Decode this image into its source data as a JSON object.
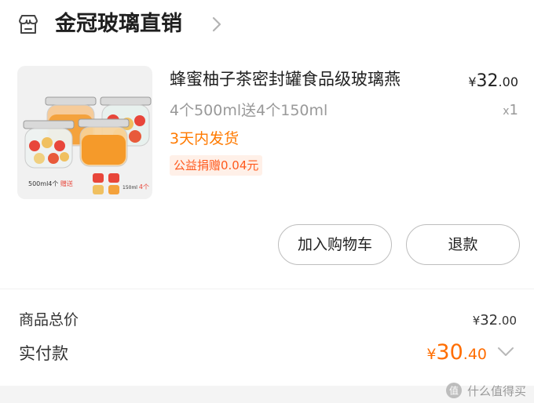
{
  "shop": {
    "name": "金冠玻璃直销"
  },
  "product": {
    "title": "蜂蜜柚子茶密封罐食品级玻璃燕",
    "price": {
      "currency": "¥",
      "integer": "32",
      "decimal": ".00"
    },
    "spec": "4个500ml送4个150ml",
    "quantity": "1",
    "quantity_prefix": "x",
    "shipping": "3天内发货",
    "charity": "公益捐赠0.04元",
    "image_caption_left": "500ml4个",
    "image_caption_gift": "赠送",
    "image_caption_right": "150ml",
    "image_caption_count": "4个"
  },
  "actions": {
    "add_to_cart": "加入购物车",
    "refund": "退款"
  },
  "summary": {
    "total_label": "商品总价",
    "total": {
      "currency": "¥",
      "integer": "32",
      "decimal": ".00"
    },
    "paid_label": "实付款",
    "paid": {
      "currency": "¥",
      "integer": "30",
      "decimal": ".40"
    }
  },
  "watermark": {
    "text": "什么值得买"
  },
  "colors": {
    "accent_orange": "#ff6d00",
    "shipping_orange": "#ff7a00",
    "charity_red": "#ff5a1e",
    "charity_bg": "#fff0e8"
  }
}
